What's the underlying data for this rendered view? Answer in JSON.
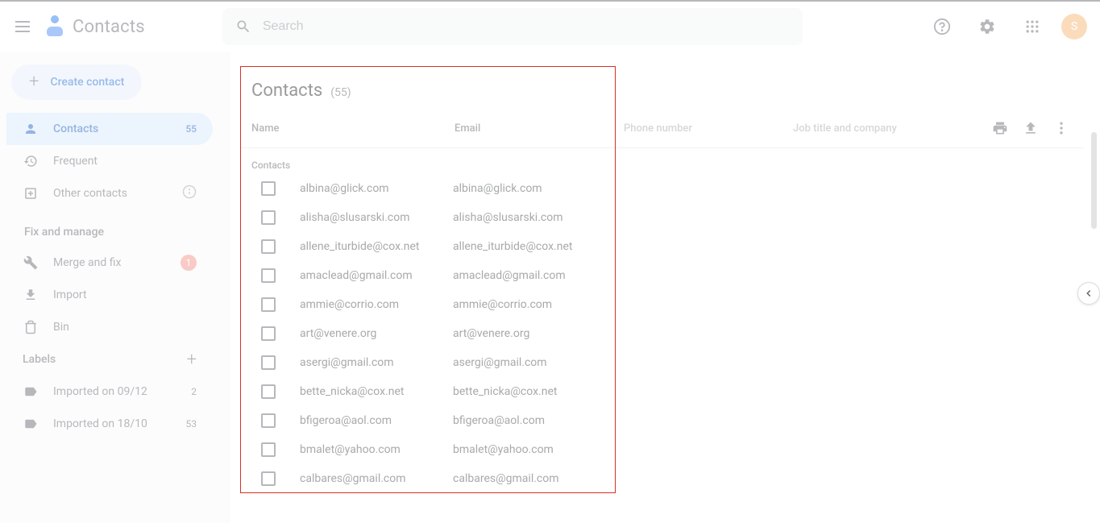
{
  "app": {
    "title": "Contacts"
  },
  "search": {
    "placeholder": "Search"
  },
  "avatar": {
    "initial": "S"
  },
  "sidebar": {
    "create_label": "Create contact",
    "contacts": {
      "label": "Contacts",
      "count": "55"
    },
    "frequent": {
      "label": "Frequent"
    },
    "other": {
      "label": "Other contacts"
    },
    "fix_manage_title": "Fix and manage",
    "merge": {
      "label": "Merge and fix",
      "badge": "1"
    },
    "import": {
      "label": "Import"
    },
    "bin": {
      "label": "Bin"
    },
    "labels_title": "Labels",
    "label1": {
      "label": "Imported on 09/12",
      "count": "2"
    },
    "label2": {
      "label": "Imported on 18/10",
      "count": "53"
    }
  },
  "main": {
    "title": "Contacts",
    "count": "(55)",
    "section_label": "Contacts",
    "columns": {
      "name": "Name",
      "email": "Email",
      "phone": "Phone number",
      "job": "Job title and company"
    }
  },
  "rows": [
    {
      "name": "albina@glick.com",
      "email": "albina@glick.com"
    },
    {
      "name": "alisha@slusarski.com",
      "email": "alisha@slusarski.com"
    },
    {
      "name": "allene_iturbide@cox.net",
      "email": "allene_iturbide@cox.net"
    },
    {
      "name": "amaclead@gmail.com",
      "email": "amaclead@gmail.com"
    },
    {
      "name": "ammie@corrio.com",
      "email": "ammie@corrio.com"
    },
    {
      "name": "art@venere.org",
      "email": "art@venere.org"
    },
    {
      "name": "asergi@gmail.com",
      "email": "asergi@gmail.com"
    },
    {
      "name": "bette_nicka@cox.net",
      "email": "bette_nicka@cox.net"
    },
    {
      "name": "bfigeroa@aol.com",
      "email": "bfigeroa@aol.com"
    },
    {
      "name": "bmalet@yahoo.com",
      "email": "bmalet@yahoo.com"
    },
    {
      "name": "calbares@gmail.com",
      "email": "calbares@gmail.com"
    }
  ]
}
